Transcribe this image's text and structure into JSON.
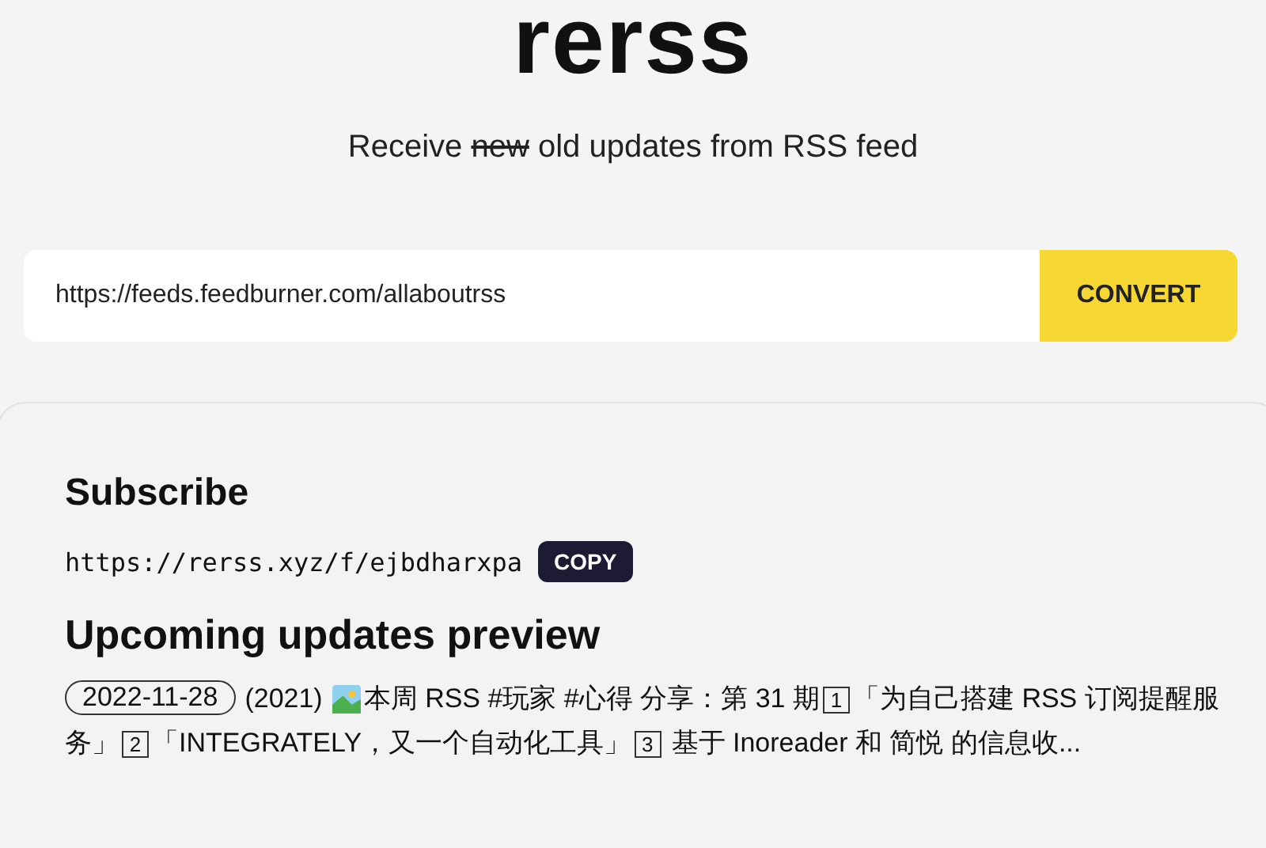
{
  "title": "rerss",
  "tagline": [
    {
      "text": "Receive ",
      "struck": false
    },
    {
      "text": "new",
      "struck": true
    },
    {
      "text": " old updates from RSS feed",
      "struck": false
    }
  ],
  "feed_input": {
    "value": "https://feeds.feedburner.com/allaboutrss"
  },
  "convert_button": "CONVERT",
  "subscribe": {
    "heading": "Subscribe",
    "url": "https://rerss.xyz/f/ejbdharxpa",
    "copy_button": "COPY"
  },
  "preview": {
    "heading": "Upcoming updates preview",
    "items": [
      {
        "date": "2022-11-28",
        "year": "(2021)",
        "parts": [
          {
            "kind": "text",
            "text": "本周 RSS #玩家 #心得 分享：第 31 期"
          },
          {
            "kind": "boxed",
            "text": "1"
          },
          {
            "kind": "text",
            "text": "「为自己搭建 RSS 订阅提醒服务」"
          },
          {
            "kind": "boxed",
            "text": "2"
          },
          {
            "kind": "text",
            "text": "「INTEGRATELY，又一个自动化工具」"
          },
          {
            "kind": "boxed",
            "text": "3"
          },
          {
            "kind": "text",
            "text": " 基于 Inoreader 和 简悦 的信息收..."
          }
        ]
      }
    ]
  }
}
